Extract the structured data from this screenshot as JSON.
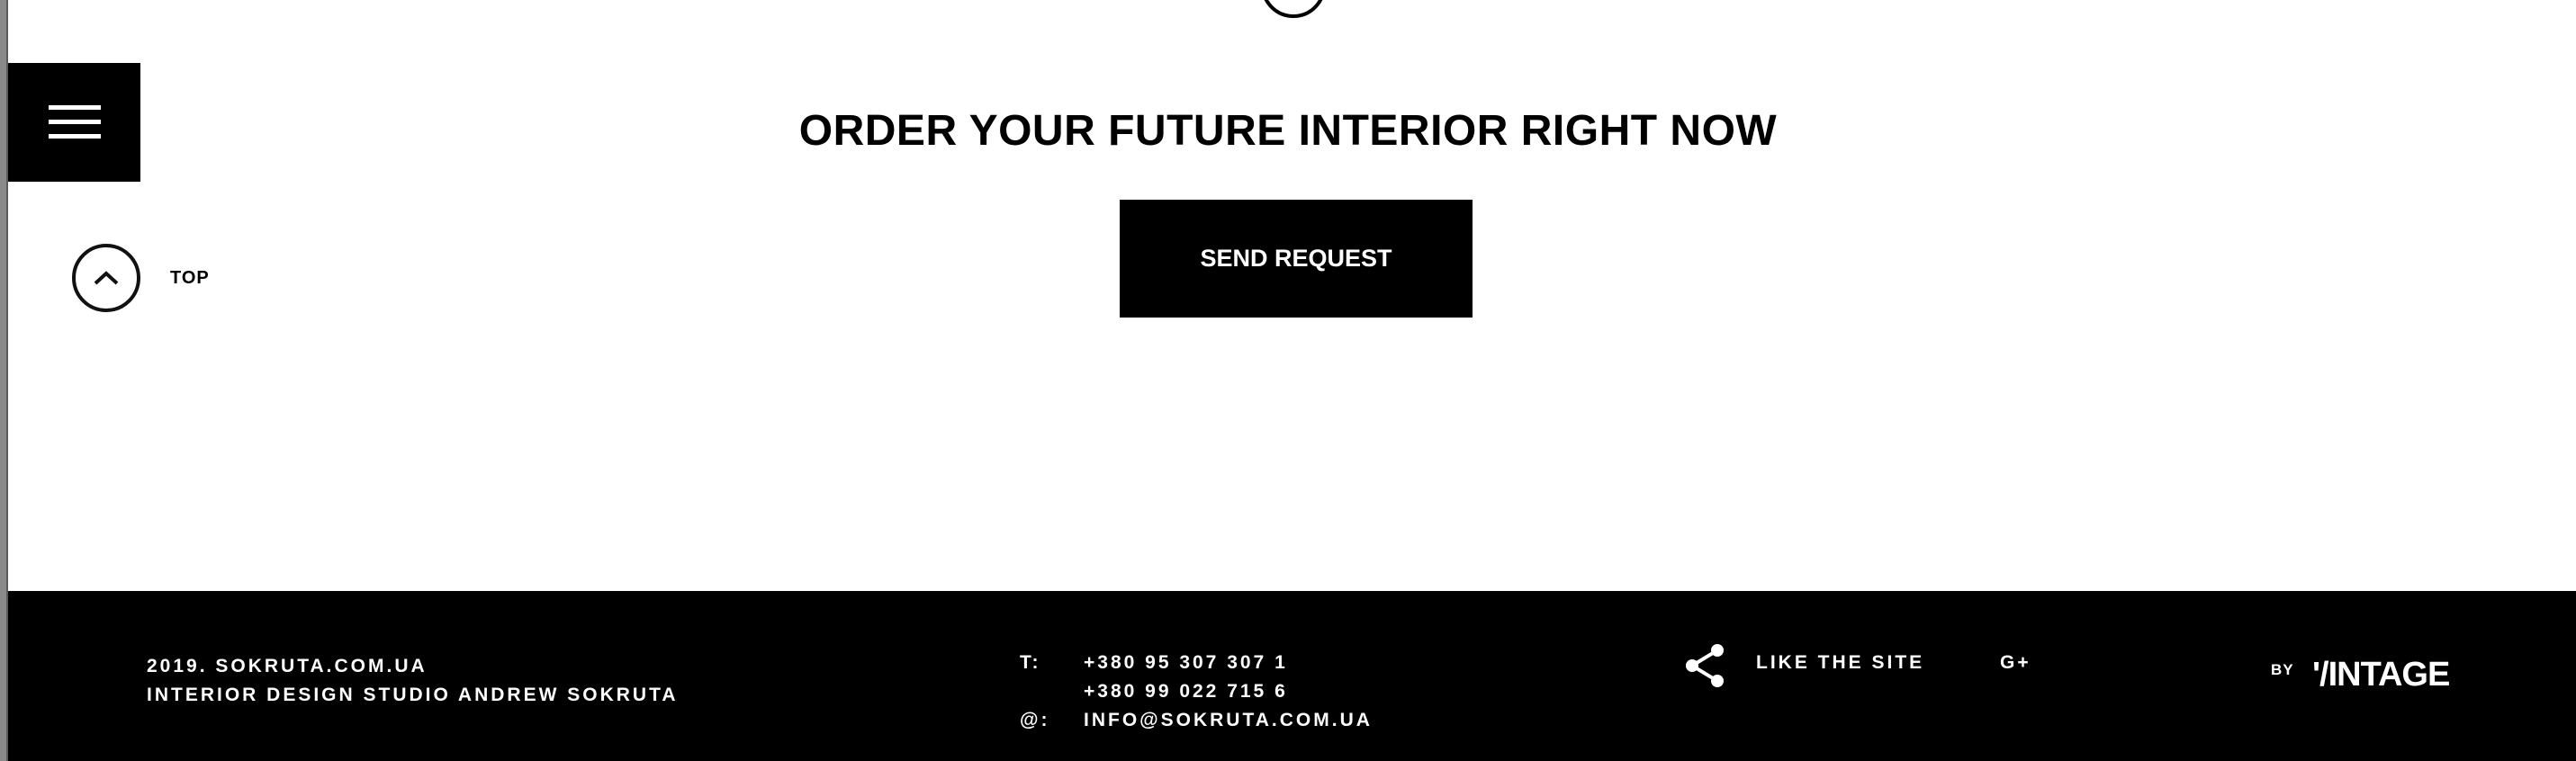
{
  "header": {
    "menu_icon": "hamburger-icon"
  },
  "scroll_top": {
    "icon": "chevron-up-icon",
    "label": "TOP"
  },
  "cta": {
    "headline": "ORDER YOUR FUTURE INTERIOR RIGHT NOW",
    "button_label": "SEND REQUEST"
  },
  "footer": {
    "copyright": "2019. SOKRUTA.COM.UA",
    "studio": "INTERIOR DESIGN STUDIO ANDREW SOKRUTA",
    "phone_label": "T:",
    "phone_1": "+380 95 307 307 1",
    "phone_2": "+380 99 022 715 6",
    "email_label": "@:",
    "email": "INFO@SOKRUTA.COM.UA",
    "share_icon": "share-icon",
    "like_label": "LIKE THE SITE",
    "gplus_label": "G+",
    "by_label": "BY",
    "brand_logo": "'/INTAGE"
  },
  "colors": {
    "background": "#ffffff",
    "footer_bg": "#000000",
    "text_dark": "#000000",
    "text_light": "#ffffff"
  }
}
